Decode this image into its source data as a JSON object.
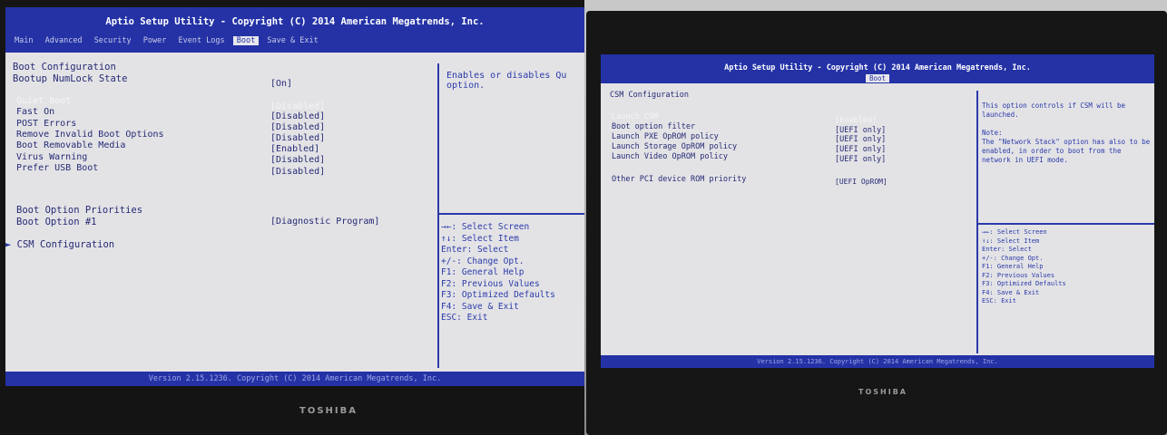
{
  "left": {
    "title": "Aptio Setup Utility - Copyright (C) 2014 American Megatrends, Inc.",
    "menu": [
      "Main",
      "Advanced",
      "Security",
      "Power",
      "Event Logs",
      "Boot",
      "Save & Exit"
    ],
    "active_menu": "Boot",
    "section_title": "Boot Configuration",
    "rows": [
      {
        "label": "Bootup NumLock State",
        "value": "[On]"
      },
      {
        "label": "Quiet Boot",
        "value": "[Disabled]",
        "highlighted": true
      },
      {
        "label": "Fast On",
        "value": "[Disabled]"
      },
      {
        "label": "POST Errors",
        "value": "[Disabled]"
      },
      {
        "label": "Remove Invalid Boot Options",
        "value": "[Disabled]"
      },
      {
        "label": "Boot Removable Media",
        "value": "[Enabled]"
      },
      {
        "label": "Virus Warning",
        "value": "[Disabled]"
      },
      {
        "label": "Prefer USB Boot",
        "value": "[Disabled]"
      }
    ],
    "priorities_title": "Boot Option Priorities",
    "boot_option_label": "Boot Option #1",
    "boot_option_value": "[Diagnostic Program]",
    "submenu": "CSM Configuration",
    "help": "Enables or disables Qu option.",
    "keys": [
      "→←: Select Screen",
      "↑↓: Select Item",
      "Enter: Select",
      "+/-: Change Opt.",
      "F1: General Help",
      "F2: Previous Values",
      "F3: Optimized Defaults",
      "F4: Save & Exit",
      "ESC: Exit"
    ],
    "footer": "Version 2.15.1236. Copyright (C) 2014 American Megatrends, Inc.",
    "brand": "TOSHIBA"
  },
  "right": {
    "title": "Aptio Setup Utility - Copyright (C) 2014 American Megatrends, Inc.",
    "active_menu": "Boot",
    "section_title": "CSM Configuration",
    "rows": [
      {
        "label": "Launch CSM",
        "value": "[Enabled]",
        "highlighted": true
      },
      {
        "label": "Boot option filter",
        "value": "[UEFI only]"
      },
      {
        "label": "Launch PXE OpROM policy",
        "value": "[UEFI only]"
      },
      {
        "label": "Launch Storage OpROM policy",
        "value": "[UEFI only]"
      },
      {
        "label": "Launch Video OpROM policy",
        "value": "[UEFI only]"
      }
    ],
    "other_label": "Other PCI device ROM priority",
    "other_value": "[UEFI OpROM]",
    "help": "This option controls if CSM will be launched.\n\nNote:\nThe \"Network Stack\" option has also to be enabled, in order to boot from the network in UEFI mode.",
    "keys": [
      "→←: Select Screen",
      "↑↓: Select Item",
      "Enter: Select",
      "+/-: Change Opt.",
      "F1: General Help",
      "F2: Previous Values",
      "F3: Optimized Defaults",
      "F4: Save & Exit",
      "ESC: Exit"
    ],
    "footer": "Version 2.15.1236. Copyright (C) 2014 American Megatrends, Inc.",
    "brand": "TOSHIBA"
  },
  "colors": {
    "bios_blue": "#2432a6",
    "bios_text": "#262a74",
    "bios_bg": "#e3e3e6",
    "bezel": "#141414"
  }
}
